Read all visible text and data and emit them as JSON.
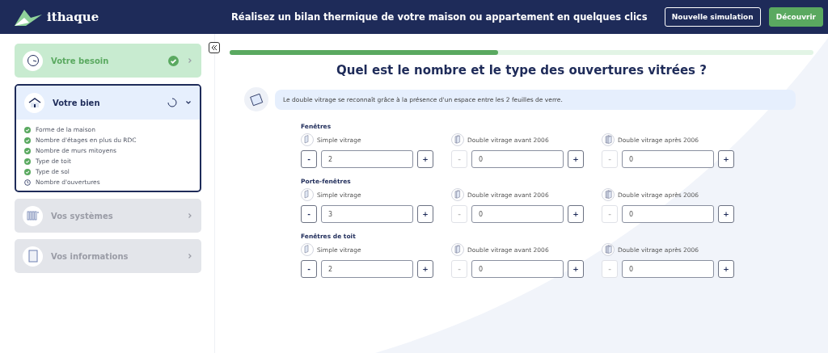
{
  "header": {
    "logo": "ithaque",
    "title": "Réalisez un bilan thermique de votre maison ou appartement en quelques clics",
    "buttons": [
      {
        "label": "Nouvelle simulation",
        "kind": "outline"
      },
      {
        "label": "Découvrir",
        "kind": "primary"
      }
    ]
  },
  "steps": [
    {
      "label": "Votre besoin",
      "kind": "done"
    },
    {
      "label": "Votre bien",
      "kind": "active",
      "expanded": true,
      "children": [
        {
          "label": "Forme de la maison",
          "done": true
        },
        {
          "label": "Nombre d'étages en plus du RDC",
          "done": true
        },
        {
          "label": "Nombre de murs mitoyens",
          "done": true
        },
        {
          "label": "Type de toit",
          "done": true
        },
        {
          "label": "Type de sol",
          "done": true
        },
        {
          "label": "Nombre d'ouvertures",
          "done": false
        }
      ]
    },
    {
      "label": "Vos systèmes",
      "kind": "locked"
    },
    {
      "label": "Vos informations",
      "kind": "locked"
    }
  ],
  "progress": {
    "level": 0.46
  },
  "question": "Quel est le nombre et le type des ouvertures vitrées ?",
  "hint": "Le double vitrage se reconnaît grâce à la présence d'un espace entre les 2 feuilles de verre.",
  "groups": [
    {
      "title": "Fenêtres",
      "fields": [
        {
          "label": "Simple vitrage",
          "value": "2",
          "minus": "-",
          "plus": "+",
          "minus_disabled": false
        },
        {
          "label": "Double vitrage avant 2006",
          "value": "0",
          "minus": "-",
          "plus": "+",
          "minus_disabled": true
        },
        {
          "label": "Double vitrage après 2006",
          "value": "0",
          "minus": "-",
          "plus": "+",
          "minus_disabled": true
        }
      ]
    },
    {
      "title": "Porte-fenêtres",
      "fields": [
        {
          "label": "Simple vitrage",
          "value": "3",
          "minus": "-",
          "plus": "+",
          "minus_disabled": false
        },
        {
          "label": "Double vitrage avant 2006",
          "value": "0",
          "minus": "-",
          "plus": "+",
          "minus_disabled": true
        },
        {
          "label": "Double vitrage après 2006",
          "value": "0",
          "minus": "-",
          "plus": "+",
          "minus_disabled": true
        }
      ]
    },
    {
      "title": "Fenêtres de toit",
      "fields": [
        {
          "label": "Simple vitrage",
          "value": "2",
          "minus": "-",
          "plus": "+",
          "minus_disabled": false
        },
        {
          "label": "Double vitrage avant 2006",
          "value": "0",
          "minus": "-",
          "plus": "+",
          "minus_disabled": true
        },
        {
          "label": "Double vitrage après 2006",
          "value": "0",
          "minus": "-",
          "plus": "+",
          "minus_disabled": true
        }
      ]
    }
  ]
}
